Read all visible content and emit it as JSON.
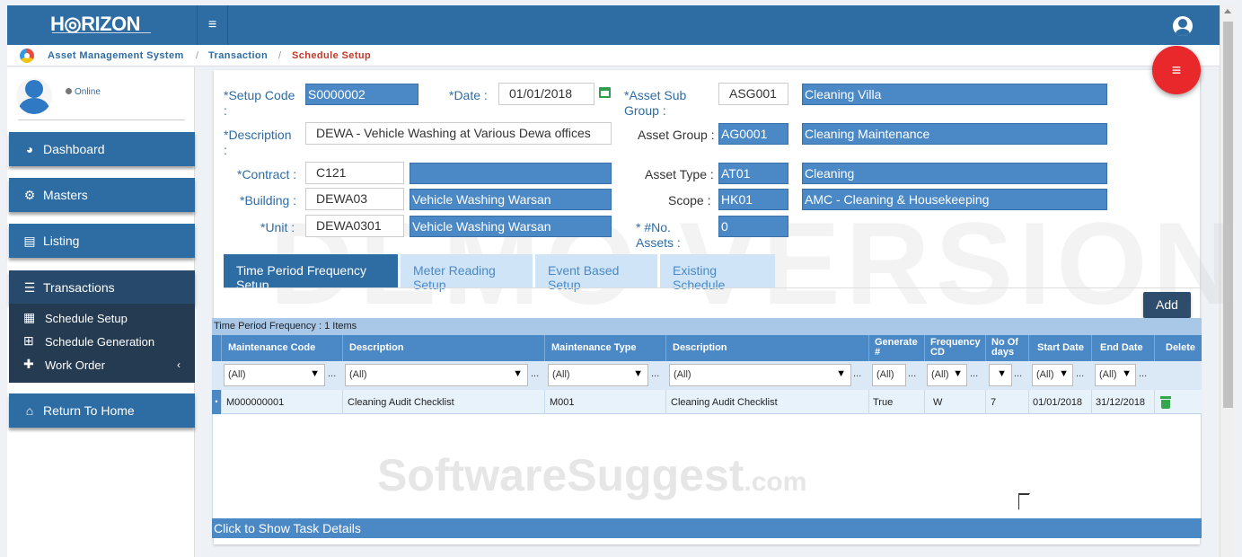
{
  "app": {
    "logo_text": "H◎RIZON",
    "hamburger": "≡"
  },
  "breadcrumb": [
    "Asset Management System",
    "Transaction",
    "Schedule Setup"
  ],
  "breadcrumb_sep": "/",
  "user": {
    "status": "Online"
  },
  "sidebar": {
    "items": [
      {
        "label": "Dashboard",
        "icon": "dashboard-icon"
      },
      {
        "label": "Masters",
        "icon": "gears-icon"
      },
      {
        "label": "Listing",
        "icon": "file-icon"
      },
      {
        "label": "Transactions",
        "icon": "list-icon"
      }
    ],
    "submenu": [
      {
        "label": "Schedule Setup",
        "icon": "calendar-icon"
      },
      {
        "label": "Schedule Generation",
        "icon": "calendar-plus-icon"
      },
      {
        "label": "Work Order",
        "icon": "puzzle-icon",
        "chevron": "‹"
      }
    ],
    "return_home": "Return To Home"
  },
  "form": {
    "setup_code": {
      "label": "*Setup Code",
      "colon": ":",
      "value": "S0000002"
    },
    "date": {
      "label": "*Date :",
      "value": "01/01/2018"
    },
    "asset_sub_group": {
      "label": "*Asset Sub Group :",
      "code": "ASG001",
      "name": "Cleaning Villa"
    },
    "description": {
      "label": "*Description",
      "colon": ":",
      "value": "DEWA - Vehicle Washing at Various Dewa offices"
    },
    "asset_group": {
      "label": "Asset Group :",
      "code": "AG0001",
      "name": "Cleaning Maintenance"
    },
    "contract": {
      "label": "*Contract :",
      "code": "C121",
      "name": ""
    },
    "asset_type": {
      "label": "Asset Type :",
      "code": "AT01",
      "name": "Cleaning"
    },
    "building": {
      "label": "*Building :",
      "code": "DEWA03",
      "name": "Vehicle Washing Warsan"
    },
    "scope": {
      "label": "Scope :",
      "code": "HK01",
      "name": "AMC - Cleaning & Housekeeping"
    },
    "unit": {
      "label": "*Unit :",
      "code": "DEWA0301",
      "name": "Vehicle Washing Warsan"
    },
    "no_assets": {
      "label1": "* #No.",
      "label2": "Assets :",
      "value": "0"
    }
  },
  "tabs": [
    "Time Period Frequency Setup",
    "Meter Reading Setup",
    "Event Based Setup",
    "Existing Schedule"
  ],
  "add_button": "Add",
  "grid": {
    "caption": "Time Period Frequency : 1 Items",
    "columns": [
      "Maintenance Code",
      "Description",
      "Maintenance Type",
      "Description",
      "Generate #",
      "Frequency CD",
      "No Of days",
      "Start Date",
      "End Date",
      "Delete"
    ],
    "filter": "(All)",
    "rows": [
      [
        "M000000001",
        "Cleaning Audit Checklist",
        "M001",
        "Cleaning Audit Checklist",
        "True",
        "W",
        "7",
        "01/01/2018",
        "31/12/2018"
      ]
    ]
  },
  "task_details": "Click to Show Task Details",
  "watermarks": {
    "demo": "DEMO VERSION",
    "brand": "SoftwareSuggest",
    "brand_suffix": ".com"
  }
}
